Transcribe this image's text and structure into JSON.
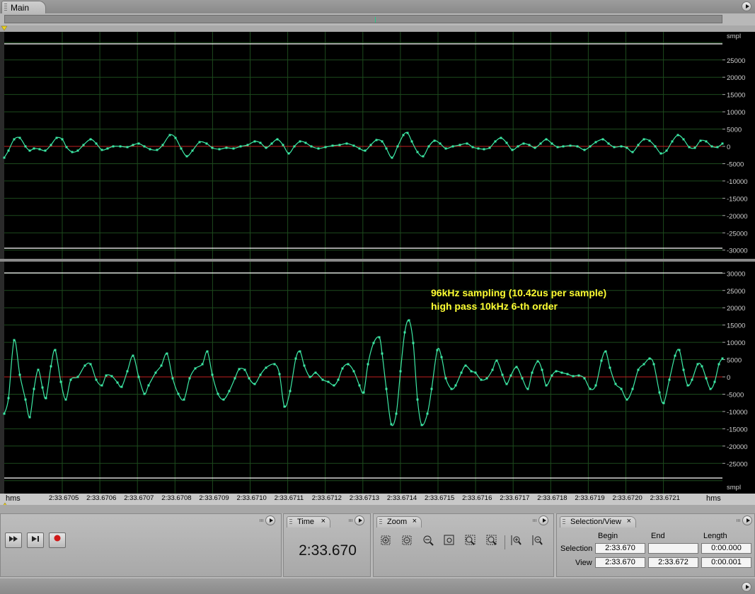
{
  "window": {
    "tab_label": "Main"
  },
  "colors": {
    "background": "#000000",
    "grid": "#1d4a1d",
    "waveform": "#3ce8a4",
    "zero_line": "#c02020",
    "annotation": "#ffff33",
    "boundary": "#ffffff"
  },
  "amplitude_ruler": {
    "unit": "smpl",
    "top_channel": [
      "25000",
      "20000",
      "15000",
      "10000",
      "5000",
      "0",
      "-5000",
      "-10000",
      "-15000",
      "-20000",
      "-25000",
      "-30000"
    ],
    "bottom_channel": [
      "30000",
      "25000",
      "20000",
      "15000",
      "10000",
      "5000",
      "0",
      "-5000",
      "-10000",
      "-15000",
      "-20000",
      "-25000"
    ],
    "bottom_unit": "smpl"
  },
  "annotation": {
    "line1": "96kHz sampling (10.42us per sample)",
    "line2": "high pass 10kHz 6-th order"
  },
  "time_ruler": {
    "left_unit": "hms",
    "right_unit": "hms",
    "ticks": [
      "2:33.6705",
      "2:33.6706",
      "2:33.6707",
      "2:33.6708",
      "2:33.6709",
      "2:33.6710",
      "2:33.6711",
      "2:33.6712",
      "2:33.6713",
      "2:33.6714",
      "2:33.6715",
      "2:33.6716",
      "2:33.6717",
      "2:33.6718",
      "2:33.6719",
      "2:33.6720",
      "2:33.6721"
    ]
  },
  "transport": {
    "icons": [
      "fast-forward-icon",
      "skip-to-end-icon",
      "record-icon"
    ]
  },
  "time_panel": {
    "title": "Time",
    "close": "×",
    "value": "2:33.670"
  },
  "zoom_panel": {
    "title": "Zoom",
    "close": "×",
    "buttons": [
      "zoom-in-amplitude",
      "zoom-out-amplitude",
      "zoom-out-full",
      "zoom-selection",
      "zoom-in-left",
      "zoom-in-right",
      "zoom-in-vertical",
      "zoom-out-vertical"
    ]
  },
  "selection_panel": {
    "title": "Selection/View",
    "close": "×",
    "col_begin": "Begin",
    "col_end": "End",
    "col_length": "Length",
    "row_selection": "Selection",
    "row_view": "View",
    "selection_begin": "2:33.670",
    "selection_end": "",
    "selection_length": "0:00.000",
    "view_begin": "2:33.670",
    "view_end": "2:33.672",
    "view_length": "0:00.001"
  }
}
